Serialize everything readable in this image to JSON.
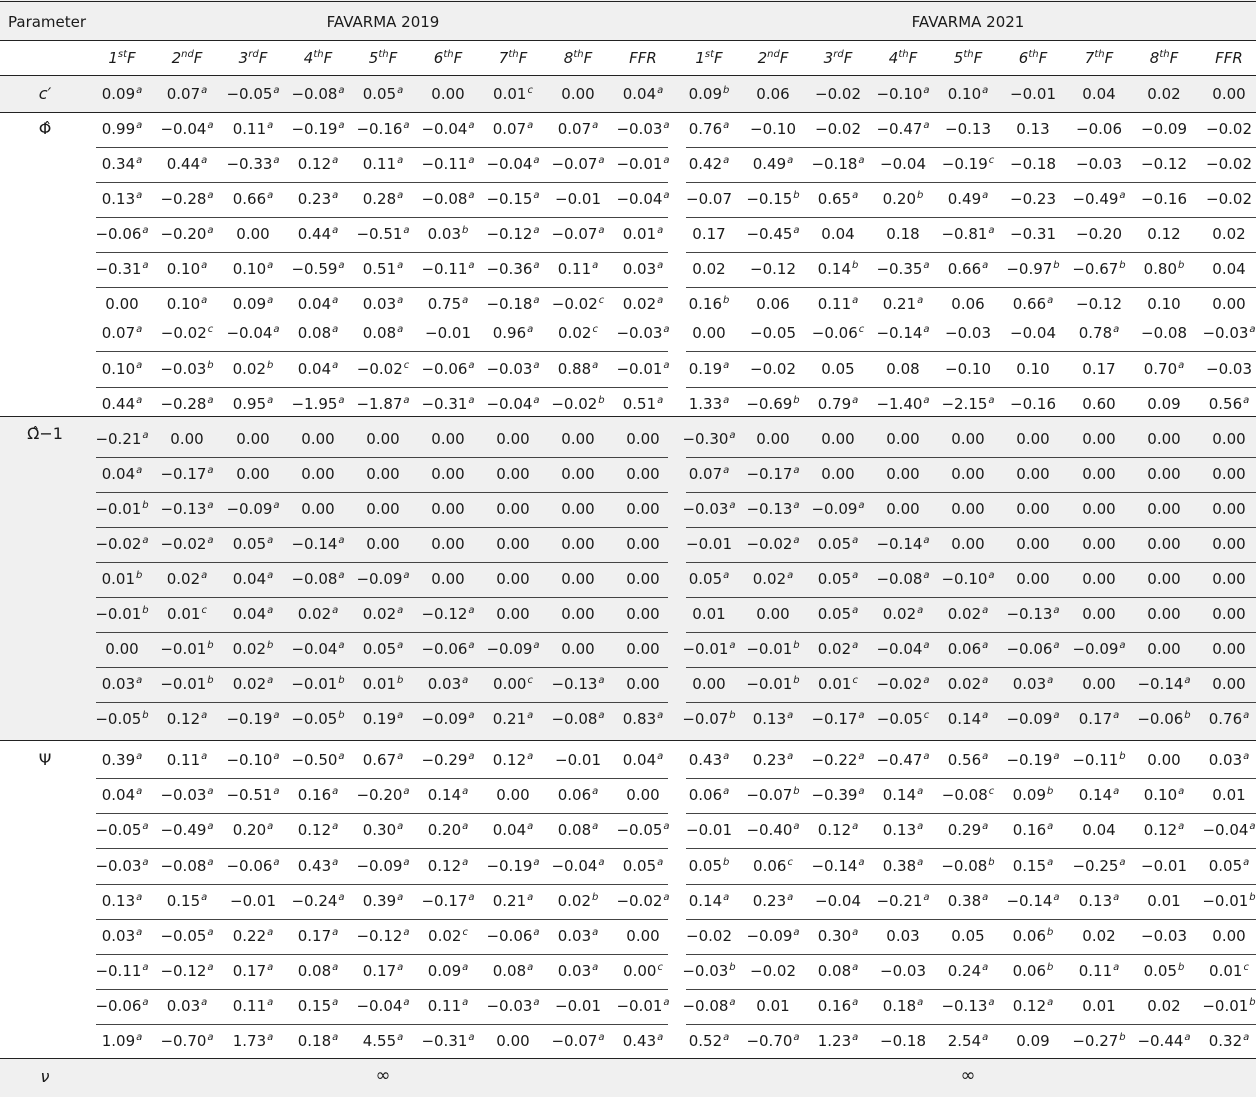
{
  "header": {
    "parameter_label": "Parameter",
    "model_left": "FAVARMA 2019",
    "model_right": "FAVARMA 2021",
    "columns": [
      {
        "base": "1",
        "sup": "st",
        "tail": "F"
      },
      {
        "base": "2",
        "sup": "nd",
        "tail": "F"
      },
      {
        "base": "3",
        "sup": "rd",
        "tail": "F"
      },
      {
        "base": "4",
        "sup": "th",
        "tail": "F"
      },
      {
        "base": "5",
        "sup": "th",
        "tail": "F"
      },
      {
        "base": "6",
        "sup": "th",
        "tail": "F"
      },
      {
        "base": "7",
        "sup": "th",
        "tail": "F"
      },
      {
        "base": "8",
        "sup": "th",
        "tail": "F"
      },
      {
        "base": "FFR",
        "sup": "",
        "tail": ""
      }
    ]
  },
  "groups": [
    {
      "label": "c′",
      "rows": [
        [
          "0.09^a",
          "0.07^a",
          "−0.05^a",
          "−0.08^a",
          "0.05^a",
          "0.00",
          "0.01^c",
          "0.00",
          "0.04^a",
          "0.09^b",
          "0.06",
          "−0.02",
          "−0.10^a",
          "0.10^a",
          "−0.01",
          "0.04",
          "0.02",
          "0.00"
        ]
      ]
    },
    {
      "label": "Φ̂",
      "rows": [
        [
          "0.99^a",
          "−0.04^a",
          "0.11^a",
          "−0.19^a",
          "−0.16^a",
          "−0.04^a",
          "0.07^a",
          "0.07^a",
          "−0.03^a",
          "0.76^a",
          "−0.10",
          "−0.02",
          "−0.47^a",
          "−0.13",
          "0.13",
          "−0.06",
          "−0.09",
          "−0.02"
        ],
        [
          "0.34^a",
          "0.44^a",
          "−0.33^a",
          "0.12^a",
          "0.11^a",
          "−0.11^a",
          "−0.04^a",
          "−0.07^a",
          "−0.01^a",
          "0.42^a",
          "0.49^a",
          "−0.18^a",
          "−0.04",
          "−0.19^c",
          "−0.18",
          "−0.03",
          "−0.12",
          "−0.02"
        ],
        [
          "0.13^a",
          "−0.28^a",
          "0.66^a",
          "0.23^a",
          "0.28^a",
          "−0.08^a",
          "−0.15^a",
          "−0.01",
          "−0.04^a",
          "−0.07",
          "−0.15^b",
          "0.65^a",
          "0.20^b",
          "0.49^a",
          "−0.23",
          "−0.49^a",
          "−0.16",
          "−0.02"
        ],
        [
          "−0.06^a",
          "−0.20^a",
          "0.00",
          "0.44^a",
          "−0.51^a",
          "0.03^b",
          "−0.12^a",
          "−0.07^a",
          "0.01^a",
          "0.17",
          "−0.45^a",
          "0.04",
          "0.18",
          "−0.81^a",
          "−0.31",
          "−0.20",
          "0.12",
          "0.02"
        ],
        [
          "−0.31^a",
          "0.10^a",
          "0.10^a",
          "−0.59^a",
          "0.51^a",
          "−0.11^a",
          "−0.36^a",
          "0.11^a",
          "0.03^a",
          "0.02",
          "−0.12",
          "0.14^b",
          "−0.35^a",
          "0.66^a",
          "−0.97^b",
          "−0.67^b",
          "0.80^b",
          "0.04"
        ],
        [
          "0.00",
          "0.10^a",
          "0.09^a",
          "0.04^a",
          "0.03^a",
          "0.75^a",
          "−0.18^a",
          "−0.02^c",
          "0.02^a",
          "0.16^b",
          "0.06",
          "0.11^a",
          "0.21^a",
          "0.06",
          "0.66^a",
          "−0.12",
          "0.10",
          "0.00"
        ],
        [
          "0.07^a",
          "−0.02^c",
          "−0.04^a",
          "0.08^a",
          "0.08^a",
          "−0.01",
          "0.96^a",
          "0.02^c",
          "−0.03^a",
          "0.00",
          "−0.05",
          "−0.06^c",
          "−0.14^a",
          "−0.03",
          "−0.04",
          "0.78^a",
          "−0.08",
          "−0.03^a"
        ],
        [
          "0.10^a",
          "−0.03^b",
          "0.02^b",
          "0.04^a",
          "−0.02^c",
          "−0.06^a",
          "−0.03^a",
          "0.88^a",
          "−0.01^a",
          "0.19^a",
          "−0.02",
          "0.05",
          "0.08",
          "−0.10",
          "0.10",
          "0.17",
          "0.70^a",
          "−0.03"
        ],
        [
          "0.44^a",
          "−0.28^a",
          "0.95^a",
          "−1.95^a",
          "−1.87^a",
          "−0.31^a",
          "−0.04^a",
          "−0.02^b",
          "0.51^a",
          "1.33^a",
          "−0.69^b",
          "0.79^a",
          "−1.40^a",
          "−2.15^a",
          "−0.16",
          "0.60",
          "0.09",
          "0.56^a"
        ]
      ]
    },
    {
      "label": "Ω̂−1",
      "rows": [
        [
          "−0.21^a",
          "0.00",
          "0.00",
          "0.00",
          "0.00",
          "0.00",
          "0.00",
          "0.00",
          "0.00",
          "−0.30^a",
          "0.00",
          "0.00",
          "0.00",
          "0.00",
          "0.00",
          "0.00",
          "0.00",
          "0.00"
        ],
        [
          "0.04^a",
          "−0.17^a",
          "0.00",
          "0.00",
          "0.00",
          "0.00",
          "0.00",
          "0.00",
          "0.00",
          "0.07^a",
          "−0.17^a",
          "0.00",
          "0.00",
          "0.00",
          "0.00",
          "0.00",
          "0.00",
          "0.00"
        ],
        [
          "−0.01^b",
          "−0.13^a",
          "−0.09^a",
          "0.00",
          "0.00",
          "0.00",
          "0.00",
          "0.00",
          "0.00",
          "−0.03^a",
          "−0.13^a",
          "−0.09^a",
          "0.00",
          "0.00",
          "0.00",
          "0.00",
          "0.00",
          "0.00"
        ],
        [
          "−0.02^a",
          "−0.02^a",
          "0.05^a",
          "−0.14^a",
          "0.00",
          "0.00",
          "0.00",
          "0.00",
          "0.00",
          "−0.01",
          "−0.02^a",
          "0.05^a",
          "−0.14^a",
          "0.00",
          "0.00",
          "0.00",
          "0.00",
          "0.00"
        ],
        [
          "0.01^b",
          "0.02^a",
          "0.04^a",
          "−0.08^a",
          "−0.09^a",
          "0.00",
          "0.00",
          "0.00",
          "0.00",
          "0.05^a",
          "0.02^a",
          "0.05^a",
          "−0.08^a",
          "−0.10^a",
          "0.00",
          "0.00",
          "0.00",
          "0.00"
        ],
        [
          "−0.01^b",
          "0.01^c",
          "0.04^a",
          "0.02^a",
          "0.02^a",
          "−0.12^a",
          "0.00",
          "0.00",
          "0.00",
          "0.01",
          "0.00",
          "0.05^a",
          "0.02^a",
          "0.02^a",
          "−0.13^a",
          "0.00",
          "0.00",
          "0.00"
        ],
        [
          "0.00",
          "−0.01^b",
          "0.02^b",
          "−0.04^a",
          "0.05^a",
          "−0.06^a",
          "−0.09^a",
          "0.00",
          "0.00",
          "−0.01^a",
          "−0.01^b",
          "0.02^a",
          "−0.04^a",
          "0.06^a",
          "−0.06^a",
          "−0.09^a",
          "0.00",
          "0.00"
        ],
        [
          "0.03^a",
          "−0.01^b",
          "0.02^a",
          "−0.01^b",
          "0.01^b",
          "0.03^a",
          "0.00^c",
          "−0.13^a",
          "0.00",
          "0.00",
          "−0.01^b",
          "0.01^c",
          "−0.02^a",
          "0.02^a",
          "0.03^a",
          "0.00",
          "−0.14^a",
          "0.00"
        ],
        [
          "−0.05^b",
          "0.12^a",
          "−0.19^a",
          "−0.05^b",
          "0.19^a",
          "−0.09^a",
          "0.21^a",
          "−0.08^a",
          "0.83^a",
          "−0.07^b",
          "0.13^a",
          "−0.17^a",
          "−0.05^c",
          "0.14^a",
          "−0.09^a",
          "0.17^a",
          "−0.06^b",
          "0.76^a"
        ]
      ]
    },
    {
      "label": "Ψ",
      "rows": [
        [
          "0.39^a",
          "0.11^a",
          "−0.10^a",
          "−0.50^a",
          "0.67^a",
          "−0.29^a",
          "0.12^a",
          "−0.01",
          "0.04^a",
          "0.43^a",
          "0.23^a",
          "−0.22^a",
          "−0.47^a",
          "0.56^a",
          "−0.19^a",
          "−0.11^b",
          "0.00",
          "0.03^a"
        ],
        [
          "0.04^a",
          "−0.03^a",
          "−0.51^a",
          "0.16^a",
          "−0.20^a",
          "0.14^a",
          "0.00",
          "0.06^a",
          "0.00",
          "0.06^a",
          "−0.07^b",
          "−0.39^a",
          "0.14^a",
          "−0.08^c",
          "0.09^b",
          "0.14^a",
          "0.10^a",
          "0.01"
        ],
        [
          "−0.05^a",
          "−0.49^a",
          "0.20^a",
          "0.12^a",
          "0.30^a",
          "0.20^a",
          "0.04^a",
          "0.08^a",
          "−0.05^a",
          "−0.01",
          "−0.40^a",
          "0.12^a",
          "0.13^a",
          "0.29^a",
          "0.16^a",
          "0.04",
          "0.12^a",
          "−0.04^a"
        ],
        [
          "−0.03^a",
          "−0.08^a",
          "−0.06^a",
          "0.43^a",
          "−0.09^a",
          "0.12^a",
          "−0.19^a",
          "−0.04^a",
          "0.05^a",
          "0.05^b",
          "0.06^c",
          "−0.14^a",
          "0.38^a",
          "−0.08^b",
          "0.15^a",
          "−0.25^a",
          "−0.01",
          "0.05^a"
        ],
        [
          "0.13^a",
          "0.15^a",
          "−0.01",
          "−0.24^a",
          "0.39^a",
          "−0.17^a",
          "0.21^a",
          "0.02^b",
          "−0.02^a",
          "0.14^a",
          "0.23^a",
          "−0.04",
          "−0.21^a",
          "0.38^a",
          "−0.14^a",
          "0.13^a",
          "0.01",
          "−0.01^b"
        ],
        [
          "0.03^a",
          "−0.05^a",
          "0.22^a",
          "0.17^a",
          "−0.12^a",
          "0.02^c",
          "−0.06^a",
          "0.03^a",
          "0.00",
          "−0.02",
          "−0.09^a",
          "0.30^a",
          "0.03",
          "0.05",
          "0.06^b",
          "0.02",
          "−0.03",
          "0.00"
        ],
        [
          "−0.11^a",
          "−0.12^a",
          "0.17^a",
          "0.08^a",
          "0.17^a",
          "0.09^a",
          "0.08^a",
          "0.03^a",
          "0.00^c",
          "−0.03^b",
          "−0.02",
          "0.08^a",
          "−0.03",
          "0.24^a",
          "0.06^b",
          "0.11^a",
          "0.05^b",
          "0.01^c"
        ],
        [
          "−0.06^a",
          "0.03^a",
          "0.11^a",
          "0.15^a",
          "−0.04^a",
          "0.11^a",
          "−0.03^a",
          "−0.01",
          "−0.01^a",
          "−0.08^a",
          "0.01",
          "0.16^a",
          "0.18^a",
          "−0.13^a",
          "0.12^a",
          "0.01",
          "0.02",
          "−0.01^b"
        ],
        [
          "1.09^a",
          "−0.70^a",
          "1.73^a",
          "0.18^a",
          "4.55^a",
          "−0.31^a",
          "0.00",
          "−0.07^a",
          "0.43^a",
          "0.52^a",
          "−0.70^a",
          "1.23^a",
          "−0.18",
          "2.54^a",
          "0.09",
          "−0.27^b",
          "−0.44^a",
          "0.32^a"
        ]
      ]
    }
  ],
  "nu_row": {
    "label": "ν",
    "left": "∞",
    "right": "∞"
  }
}
